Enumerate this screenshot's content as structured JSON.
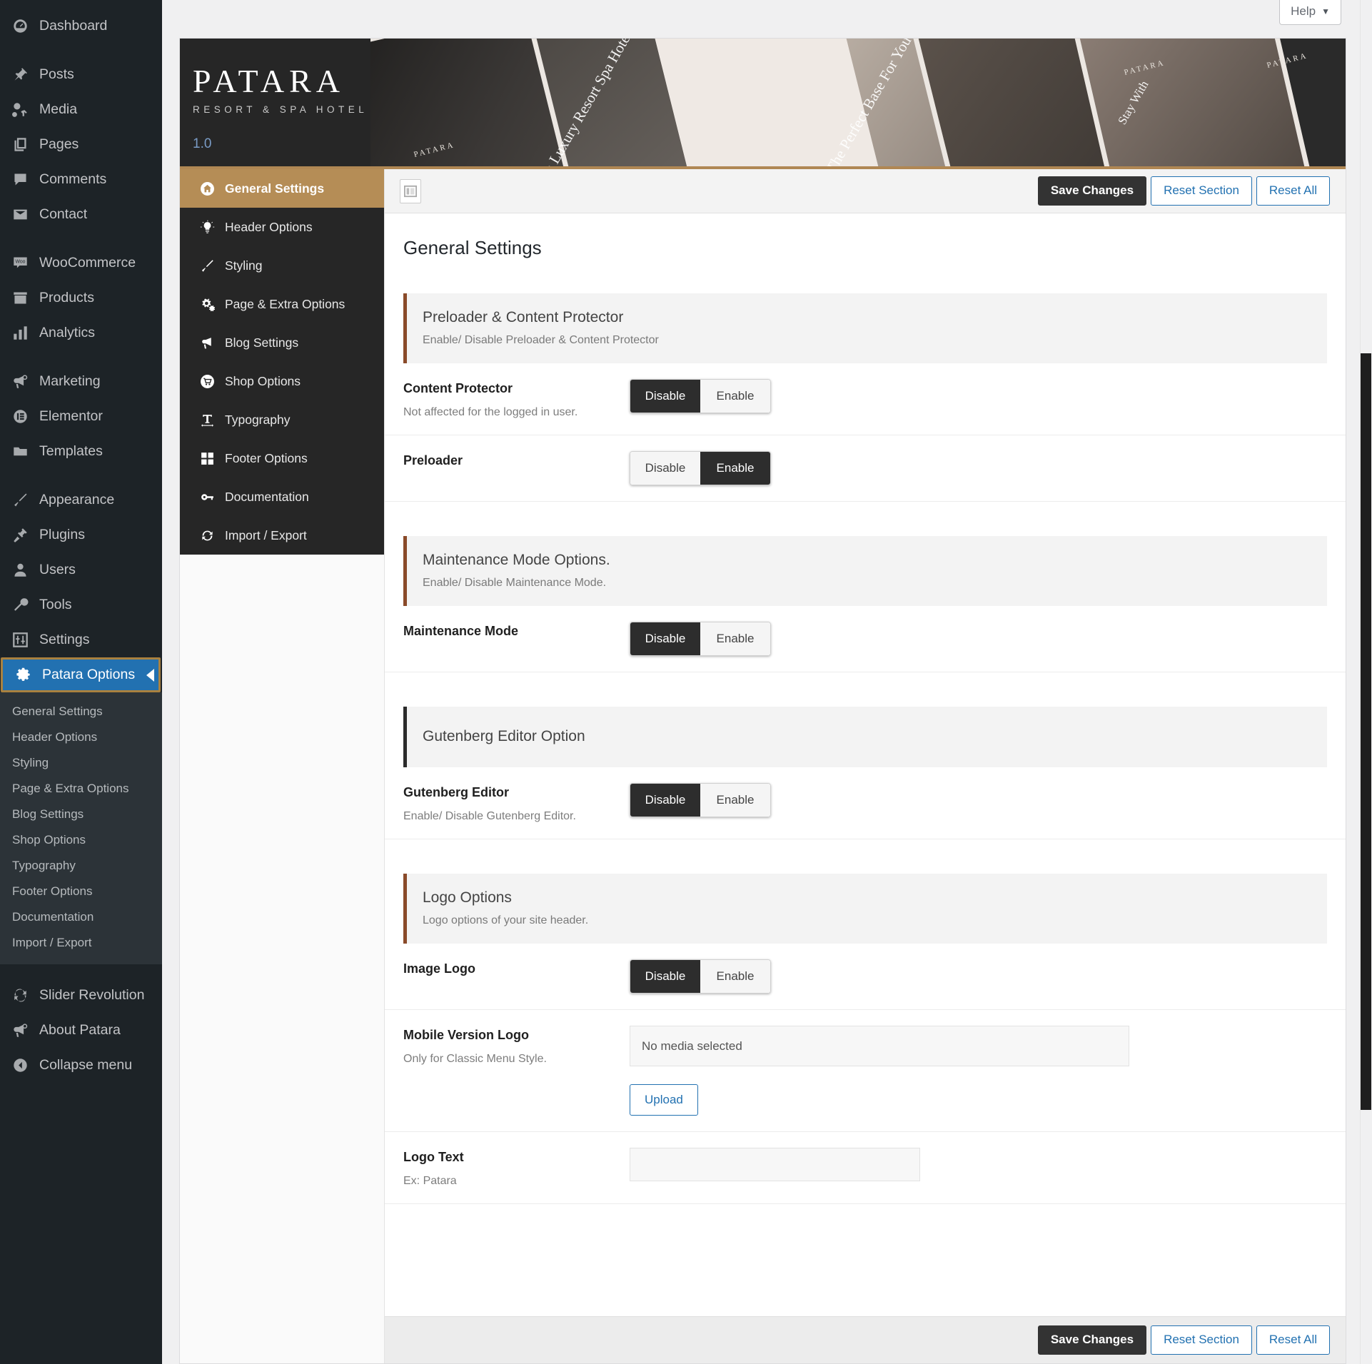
{
  "wp_sidebar": {
    "items": [
      {
        "label": "Dashboard",
        "icon": "dashboard-icon"
      },
      {
        "label": "Posts",
        "icon": "pin-icon"
      },
      {
        "label": "Media",
        "icon": "media-icon"
      },
      {
        "label": "Pages",
        "icon": "pages-icon"
      },
      {
        "label": "Comments",
        "icon": "comment-icon"
      },
      {
        "label": "Contact",
        "icon": "envelope-icon"
      },
      {
        "label": "WooCommerce",
        "icon": "woocommerce-icon"
      },
      {
        "label": "Products",
        "icon": "products-icon"
      },
      {
        "label": "Analytics",
        "icon": "bar-chart-icon"
      },
      {
        "label": "Marketing",
        "icon": "megaphone-icon"
      },
      {
        "label": "Elementor",
        "icon": "elementor-icon"
      },
      {
        "label": "Templates",
        "icon": "folder-icon"
      },
      {
        "label": "Appearance",
        "icon": "paintbrush-icon"
      },
      {
        "label": "Plugins",
        "icon": "plug-icon"
      },
      {
        "label": "Users",
        "icon": "user-icon"
      },
      {
        "label": "Tools",
        "icon": "wrench-icon"
      },
      {
        "label": "Settings",
        "icon": "sliders-icon"
      },
      {
        "label": "Patara Options",
        "icon": "gear-icon"
      }
    ],
    "current_item": "Patara Options",
    "submenu": [
      "General Settings",
      "Header Options",
      "Styling",
      "Page & Extra Options",
      "Blog Settings",
      "Shop Options",
      "Typography",
      "Footer Options",
      "Documentation",
      "Import / Export"
    ],
    "bottom_items": [
      {
        "label": "Slider Revolution",
        "icon": "slider-revolution-icon"
      },
      {
        "label": "About Patara",
        "icon": "megaphone-icon"
      },
      {
        "label": "Collapse menu",
        "icon": "collapse-icon"
      }
    ]
  },
  "help": {
    "label": "Help",
    "caret": "▼"
  },
  "brand": {
    "title": "PATARA",
    "subtitle": "RESORT & SPA HOTEL",
    "version": "1.0"
  },
  "banner": {
    "captions": [
      "Patara Luxury Resort Spa Hotel",
      "The Perfect Base For You",
      "Stay With"
    ],
    "mini_marks": [
      "PATARA",
      "PATARA",
      "PATARA"
    ]
  },
  "opt_nav": {
    "items": [
      {
        "label": "General Settings",
        "icon": "home-icon",
        "active": true
      },
      {
        "label": "Header Options",
        "icon": "lightbulb-icon",
        "active": false
      },
      {
        "label": "Styling",
        "icon": "paintbrush-icon",
        "active": false
      },
      {
        "label": "Page & Extra Options",
        "icon": "gears-icon",
        "active": false
      },
      {
        "label": "Blog Settings",
        "icon": "bullhorn-icon",
        "active": false
      },
      {
        "label": "Shop Options",
        "icon": "shopping-cart-icon",
        "active": false
      },
      {
        "label": "Typography",
        "icon": "typography-icon",
        "active": false
      },
      {
        "label": "Footer Options",
        "icon": "grid-icon",
        "active": false
      },
      {
        "label": "Documentation",
        "icon": "key-icon",
        "active": false
      },
      {
        "label": "Import / Export",
        "icon": "refresh-icon",
        "active": false
      }
    ]
  },
  "toolbar": {
    "panel_toggle_icon": "panel-layout-icon",
    "save_label": "Save Changes",
    "reset_section_label": "Reset Section",
    "reset_all_label": "Reset All"
  },
  "main": {
    "page_title": "General Settings",
    "sections": [
      {
        "id": "preloader",
        "title": "Preloader & Content Protector",
        "desc": "Enable/ Disable Preloader & Content Protector",
        "accent": "rust",
        "fields": [
          {
            "label": "Content Protector",
            "desc": "Not affected for the logged in user.",
            "type": "switch",
            "off_label": "Disable",
            "on_label": "Enable",
            "value": "Disable"
          },
          {
            "label": "Preloader",
            "desc": "",
            "type": "switch",
            "off_label": "Disable",
            "on_label": "Enable",
            "value": "Enable"
          }
        ]
      },
      {
        "id": "maintenance",
        "title": "Maintenance Mode Options.",
        "desc": "Enable/ Disable Maintenance Mode.",
        "accent": "rust",
        "fields": [
          {
            "label": "Maintenance Mode",
            "desc": "",
            "type": "switch",
            "off_label": "Disable",
            "on_label": "Enable",
            "value": "Disable"
          }
        ]
      },
      {
        "id": "gutenberg",
        "title": "Gutenberg Editor Option",
        "desc": "",
        "accent": "dark",
        "fields": [
          {
            "label": "Gutenberg Editor",
            "desc": "Enable/ Disable Gutenberg Editor.",
            "type": "switch",
            "off_label": "Disable",
            "on_label": "Enable",
            "value": "Disable"
          }
        ]
      },
      {
        "id": "logo",
        "title": "Logo Options",
        "desc": "Logo options of your site header.",
        "accent": "rust",
        "fields": [
          {
            "label": "Image Logo",
            "desc": "",
            "type": "switch",
            "off_label": "Disable",
            "on_label": "Enable",
            "value": "Disable"
          },
          {
            "label": "Mobile Version Logo",
            "desc": "Only for Classic Menu Style.",
            "type": "media",
            "media_text": "No media selected",
            "upload_label": "Upload"
          },
          {
            "label": "Logo Text",
            "desc": "Ex: Patara",
            "type": "text",
            "value": "",
            "placeholder": ""
          }
        ]
      }
    ]
  },
  "colors": {
    "wp_sidebar_bg": "#1d2327",
    "wp_current": "#2271b1",
    "wp_current_border": "#a9813f",
    "nav_active": "#b58d56",
    "section_accent": "#8a4a29",
    "section_accent_dark": "#2b2b2b",
    "link_blue": "#2271b1",
    "save_dark": "#333333"
  }
}
